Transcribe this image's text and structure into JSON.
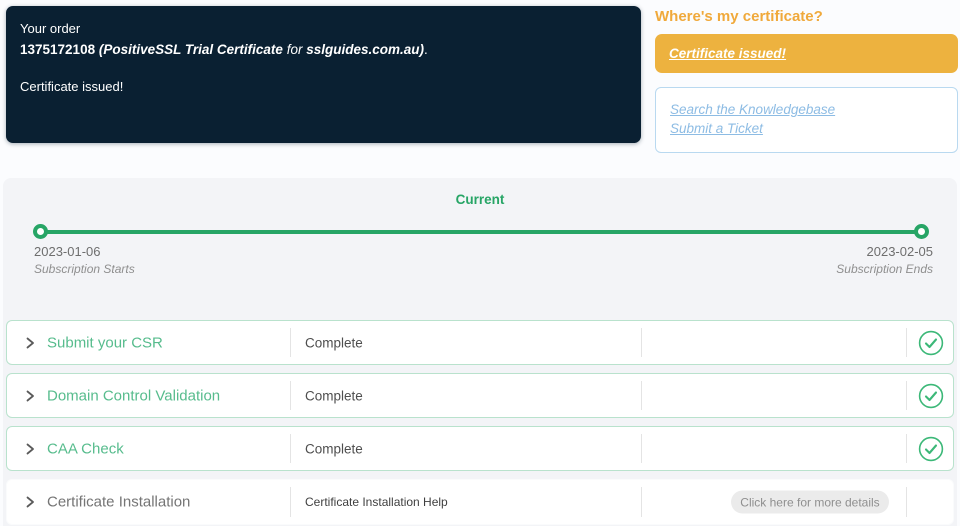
{
  "order_box": {
    "label": "Your order",
    "order_number": "1375172108",
    "product": "(PositiveSSL Trial Certificate",
    "for_word": "for",
    "domain": "sslguides.com.au)",
    "period": ".",
    "status": "Certificate issued!"
  },
  "certificate_panel": {
    "heading": "Where's my certificate?",
    "issued_button_label": "Certificate issued!",
    "links": [
      {
        "label": "Search the Knowledgebase"
      },
      {
        "label": "Submit a Ticket"
      }
    ]
  },
  "timeline": {
    "current_label": "Current",
    "start": {
      "date": "2023-01-06",
      "label": "Subscription Starts"
    },
    "end": {
      "date": "2023-02-05",
      "label": "Subscription Ends"
    }
  },
  "steps": [
    {
      "title": "Submit your CSR",
      "status": "Complete",
      "state": "complete"
    },
    {
      "title": "Domain Control Validation",
      "status": "Complete",
      "state": "complete"
    },
    {
      "title": "CAA Check",
      "status": "Complete",
      "state": "complete"
    },
    {
      "title": "Certificate Installation",
      "status": "Certificate Installation Help",
      "action_label": "Click here for more details",
      "state": "pending"
    }
  ],
  "colors": {
    "dark_box_bg": "#0a2032",
    "accent_orange": "#edb23f",
    "heading_orange": "#f0a93b",
    "link_blue": "#8dbce4",
    "green_primary": "#27a566",
    "green_title": "#57bc8d",
    "green_border": "#b9e2cd",
    "check_green": "#3cb878",
    "section_bg": "#f3f4f7",
    "pill_bg": "#ebebeb"
  }
}
